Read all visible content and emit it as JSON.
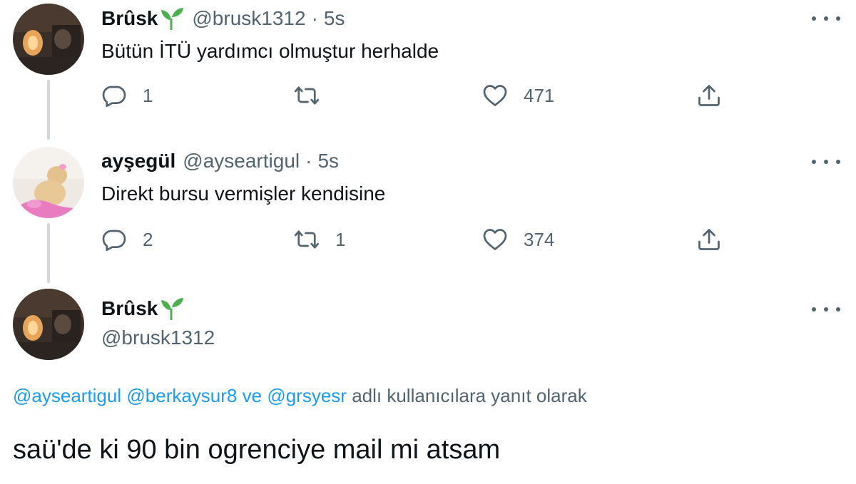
{
  "colors": {
    "accent": "#1d9bf0",
    "muted": "#536471",
    "text": "#0f1419",
    "thread_line": "#cfd9de",
    "sprout": "#4caf50"
  },
  "tweets": [
    {
      "display_name": "Brûsk",
      "name_icon": "sprout-icon",
      "handle": "@brusk1312",
      "separator": "·",
      "time": "5s",
      "text": "Bütün İTÜ yardımcı olmuştur herhalde",
      "reply_count": "1",
      "retweet_count": "",
      "like_count": "471"
    },
    {
      "display_name": "ayşegül",
      "handle": "@ayseartigul",
      "separator": "·",
      "time": "5s",
      "text": "Direkt bursu vermişler kendisine",
      "reply_count": "2",
      "retweet_count": "1",
      "like_count": "374"
    }
  ],
  "focal_tweet": {
    "display_name": "Brûsk",
    "name_icon": "sprout-icon",
    "handle": "@brusk1312",
    "reply_mentions": [
      "@ayseartigul",
      "@berkaysur8",
      "ve",
      "@grsyesr"
    ],
    "reply_suffix": "adlı kullanıcılara yanıt olarak",
    "text": "saü'de ki 90 bin ogrenciye mail mi atsam"
  }
}
